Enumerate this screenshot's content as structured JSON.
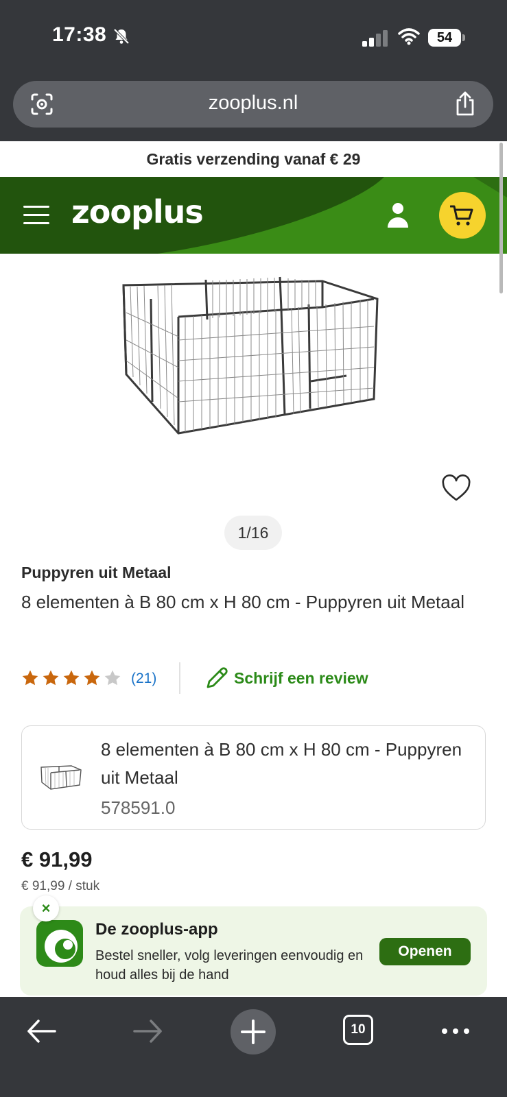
{
  "status_bar": {
    "time": "17:38",
    "battery": "54"
  },
  "browser": {
    "url": "zooplus.nl",
    "tabs_count": "10"
  },
  "site": {
    "shipping_banner": "Gratis verzending vanaf € 29",
    "logo": "zooplus"
  },
  "product": {
    "image_counter": "1/16",
    "brand_line": "Puppyren uit Metaal",
    "title": "8 elementen à B 80 cm x H 80 cm - Puppyren uit Metaal",
    "rating": 4,
    "rating_max": 5,
    "review_count": "(21)",
    "write_review_label": "Schrijf een review",
    "variant": {
      "title": "8 elementen à B 80 cm x H 80 cm - Puppyren uit Metaal",
      "sku": "578591.0"
    },
    "price": "€ 91,99",
    "unit_price": "€ 91,99 / stuk"
  },
  "app_banner": {
    "close_symbol": "×",
    "title": "De zooplus-app",
    "description": "Bestel sneller, volg leveringen eenvoudig en houd alles bij de hand",
    "open_label": "Openen"
  },
  "colors": {
    "brand_green": "#2d6e12",
    "accent_green": "#2b8a18",
    "cart_yellow": "#f6d32d",
    "star_orange": "#c9670d",
    "link_blue": "#1a73c8"
  }
}
